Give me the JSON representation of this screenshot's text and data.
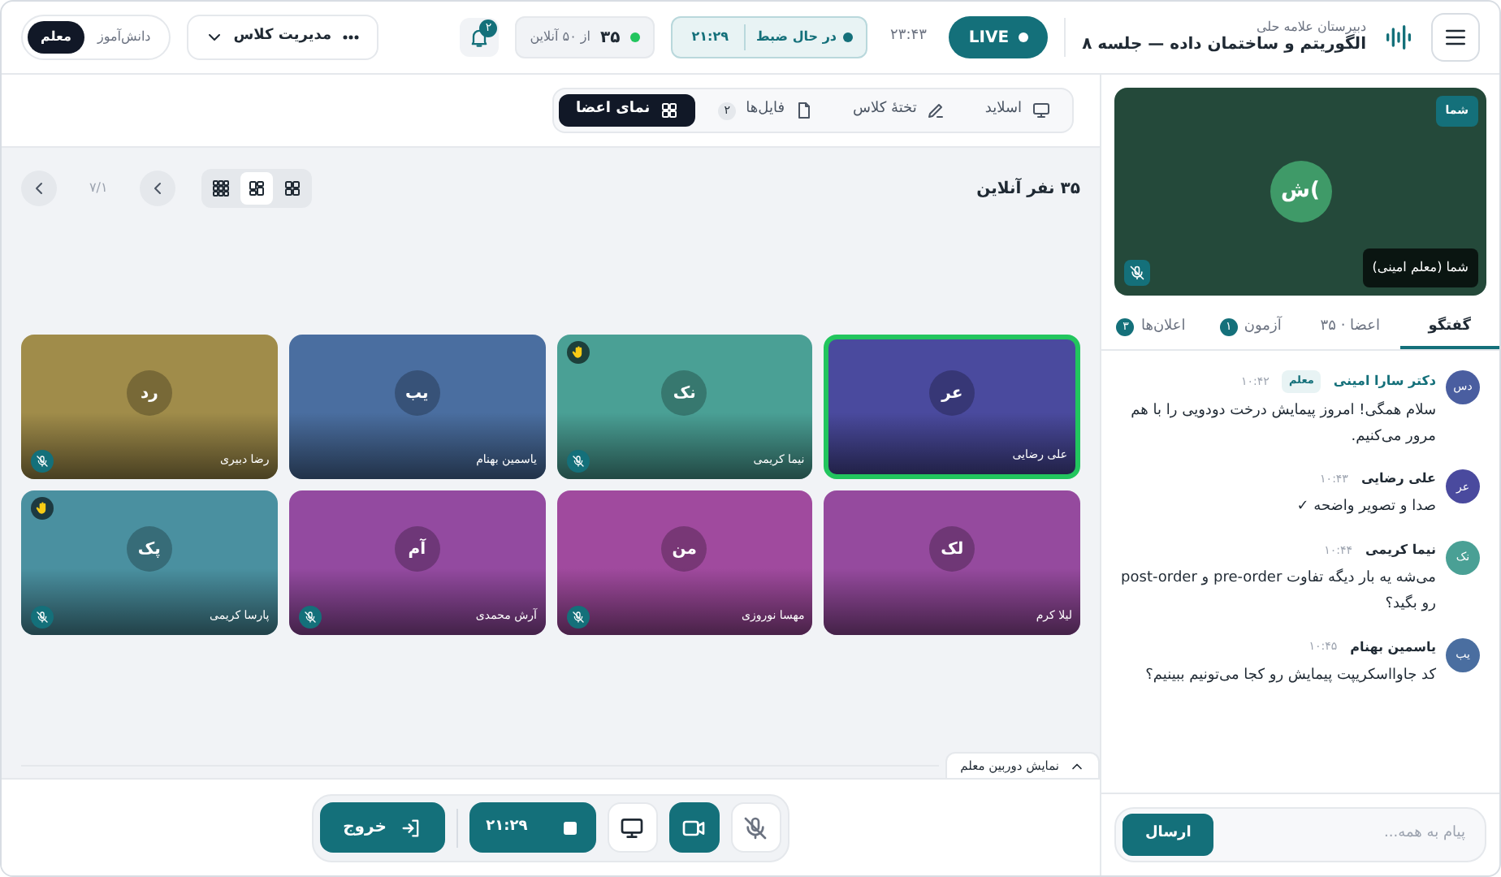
{
  "header": {
    "school": "دبیرستان علامه حلی",
    "title": "الگوریتم و ساختمان داده — جلسه ۸",
    "live_label": "LIVE",
    "clock": "۲۳:۴۳",
    "recording": {
      "on": true,
      "label": "در حال ضبط",
      "time": "۲۱:۲۹"
    },
    "online": {
      "count": "۳۵",
      "label": "از ۵۰ آنلاین"
    },
    "notification_badge": "۲",
    "class_menu": "مدیریت کلاس",
    "roles": [
      {
        "label": "دانش‌آموز",
        "selected": false
      },
      {
        "label": "معلم",
        "selected": true
      }
    ]
  },
  "view_tabs": [
    {
      "kind": "slides",
      "label": "اسلاید",
      "selected": false
    },
    {
      "kind": "whiteboard",
      "label": "تختهٔ کلاس",
      "selected": false
    },
    {
      "kind": "files",
      "label": "فایل‌ها",
      "badge": "۲",
      "selected": false
    },
    {
      "kind": "members",
      "label": "نمای اعضا",
      "selected": true
    }
  ],
  "members_panel": {
    "online_label": "۳۵ نفر آنلاین",
    "layouts": [
      {
        "kind": "grid",
        "selected": false
      },
      {
        "kind": "focus",
        "selected": true
      },
      {
        "kind": "dense",
        "selected": false
      }
    ],
    "page": "۷/۱"
  },
  "tiles": [
    {
      "initials": "عر",
      "name": "علی رضایی",
      "color": "#4a4a9e",
      "speaking": true,
      "hand_raised": false,
      "muted": false
    },
    {
      "initials": "نک",
      "name": "نیما کریمی",
      "color": "#4aa095",
      "speaking": false,
      "hand_raised": true,
      "muted": true
    },
    {
      "initials": "یب",
      "name": "یاسمین بهنام",
      "color": "#4a6ea0",
      "speaking": false,
      "hand_raised": false,
      "muted": false
    },
    {
      "initials": "رد",
      "name": "رضا دبیری",
      "color": "#a08c4a",
      "speaking": false,
      "hand_raised": false,
      "muted": true
    },
    {
      "initials": "لک",
      "name": "لیلا کرم",
      "color": "#954a9e",
      "speaking": false,
      "hand_raised": false,
      "muted": false
    },
    {
      "initials": "من",
      "name": "مهسا نوروزی",
      "color": "#a04a9e",
      "speaking": false,
      "hand_raised": false,
      "muted": true
    },
    {
      "initials": "آم",
      "name": "آرش محمدی",
      "color": "#934aa0",
      "speaking": false,
      "hand_raised": false,
      "muted": true
    },
    {
      "initials": "پک",
      "name": "پارسا کریمی",
      "color": "#4a90a0",
      "speaking": false,
      "hand_raised": true,
      "muted": true
    }
  ],
  "teacher_camera_toggle": {
    "label": "نمایش دوربین معلم",
    "expanded": true
  },
  "controls": [
    {
      "kind": "mic",
      "on": false
    },
    {
      "kind": "camera",
      "on": true
    },
    {
      "kind": "screen",
      "on": false
    },
    {
      "kind": "record",
      "on": true,
      "label": "۲۱:۲۹"
    },
    {
      "kind": "exit",
      "label": "خروج"
    }
  ],
  "self_view": {
    "initials": "ش(",
    "badge": "شما",
    "name": "شما (معلم امینی)",
    "muted": true
  },
  "sidebar_tabs": [
    {
      "label": "گفتگو",
      "selected": true
    },
    {
      "label": "اعضا · ۳۵",
      "selected": false
    },
    {
      "label": "آزمون",
      "badge": "۱",
      "selected": false
    },
    {
      "label": "اعلان‌ها",
      "badge": "۳",
      "selected": false
    }
  ],
  "messages": [
    {
      "initials": "دس",
      "color": "#4a5ea0",
      "author": "دکتر سارا امینی",
      "teacher": true,
      "role_badge": "معلم",
      "time": "۱۰:۴۲",
      "text": "سلام همگی! امروز پیمایش درخت دودویی را با هم مرور می‌کنیم."
    },
    {
      "initials": "عر",
      "color": "#4a4a9e",
      "author": "علی رضایی",
      "teacher": false,
      "time": "۱۰:۴۳",
      "text": "صدا و تصویر واضحه ✓"
    },
    {
      "initials": "نک",
      "color": "#4aa095",
      "author": "نیما کریمی",
      "teacher": false,
      "time": "۱۰:۴۴",
      "text": "می‌شه یه بار دیگه تفاوت pre-order و post-order رو بگید؟"
    },
    {
      "initials": "یب",
      "color": "#4a6ea0",
      "author": "یاسمین بهنام",
      "teacher": false,
      "time": "۱۰:۴۵",
      "text": "کد جاوااسکریپت پیمایش رو کجا می‌تونیم ببینیم؟"
    }
  ],
  "composer": {
    "placeholder": "پیام به همه...",
    "send": "ارسال"
  }
}
